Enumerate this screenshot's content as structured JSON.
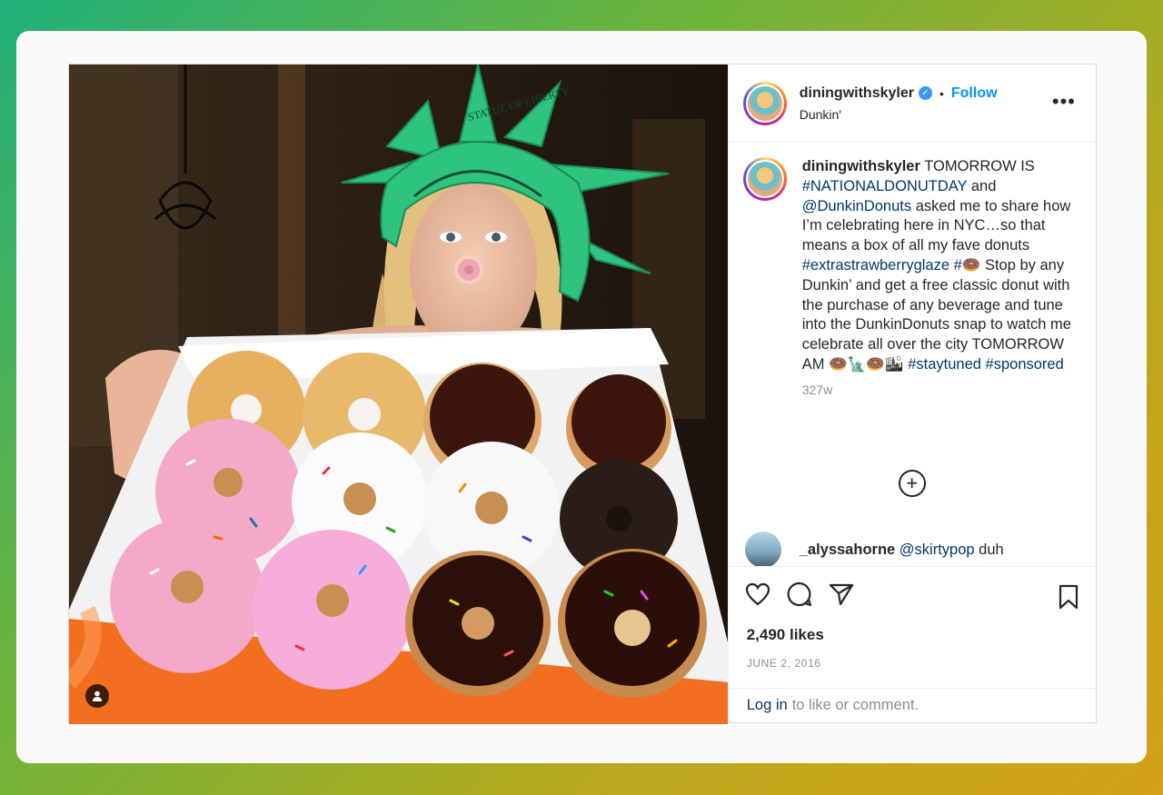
{
  "post": {
    "username": "diningwithskyler",
    "verified_mark": "✓",
    "separator": "•",
    "follow_label": "Follow",
    "location": "Dunkin'",
    "more_icon": "•••"
  },
  "caption": {
    "username": "diningwithskyler",
    "text_parts": [
      {
        "text": "TOMORROW IS ",
        "tag": false
      },
      {
        "text": "#NATIONALDONUTDAY",
        "tag": true
      },
      {
        "text": " and ",
        "tag": false
      },
      {
        "text": "@DunkinDonuts",
        "tag": true
      },
      {
        "text": " asked me to share how I’m celebrating here in NYC…so that means a box of all my fave donuts ",
        "tag": false
      },
      {
        "text": "#extrastrawberryglaze",
        "tag": true
      },
      {
        "text": " ",
        "tag": false
      },
      {
        "text": "#🍩",
        "tag": true
      },
      {
        "text": " Stop by any Dunkin’ and get a free classic donut with the purchase of any beverage and tune into the DunkinDonuts snap to watch me celebrate all over the city TOMORROW AM 🍩🗽🍩🏙 ",
        "tag": false
      },
      {
        "text": "#staytuned",
        "tag": true
      },
      {
        "text": " ",
        "tag": false
      },
      {
        "text": "#sponsored",
        "tag": true
      }
    ],
    "age": "327w"
  },
  "load_more_icon": "+",
  "comment": {
    "username": "_alyssahorne",
    "mention": "@skirtypop",
    "text": " duh"
  },
  "actions": {
    "icons": [
      "heart-icon",
      "comment-icon",
      "share-icon",
      "bookmark-icon"
    ]
  },
  "likes": "2,490 likes",
  "date": "JUNE 2, 2016",
  "login": {
    "link": "Log in",
    "rest": "to like or comment."
  },
  "colors": {
    "link": "#0095f6",
    "hashtag": "#00376b",
    "muted": "#8e8e8e",
    "box_orange": "#f26f21",
    "crown_green": "#2ec37e"
  }
}
